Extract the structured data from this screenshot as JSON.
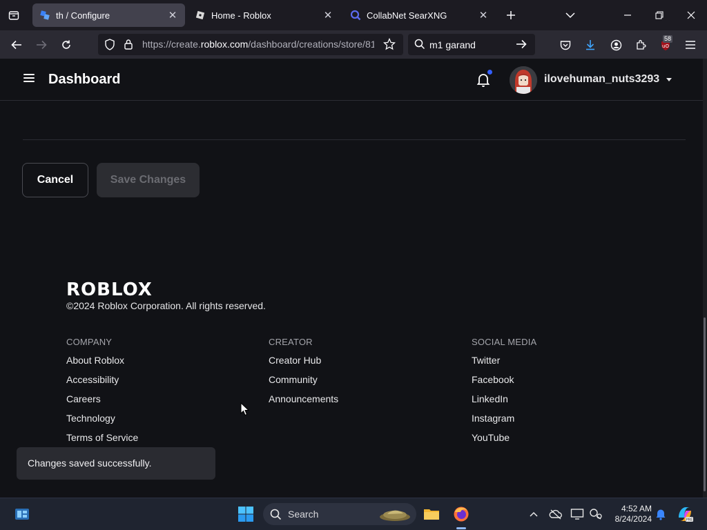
{
  "browser": {
    "tabs": [
      {
        "title": "th / Configure",
        "active": true,
        "icon": "roblox-creator-icon"
      },
      {
        "title": "Home - Roblox",
        "active": false,
        "icon": "roblox-icon"
      },
      {
        "title": "CollabNet SearXNG",
        "active": false,
        "icon": "searxng-icon"
      }
    ],
    "url_prefix": "https://create.",
    "url_domain": "roblox.com",
    "url_rest": "/dashboard/creations/store/81",
    "search_query": "m1 garand",
    "extension_badge": "58"
  },
  "header": {
    "title": "Dashboard",
    "username": "ilovehuman_nuts3293"
  },
  "actions": {
    "cancel_label": "Cancel",
    "save_label": "Save Changes"
  },
  "footer": {
    "logo": "ROBLOX",
    "copyright": "©2024 Roblox Corporation. All rights reserved.",
    "columns": [
      {
        "heading": "COMPANY",
        "links": [
          "About Roblox",
          "Accessibility",
          "Careers",
          "Technology",
          "Terms of Service"
        ]
      },
      {
        "heading": "CREATOR",
        "links": [
          "Creator Hub",
          "Community",
          "Announcements"
        ]
      },
      {
        "heading": "SOCIAL MEDIA",
        "links": [
          "Twitter",
          "Facebook",
          "LinkedIn",
          "Instagram",
          "YouTube"
        ]
      }
    ]
  },
  "toast": {
    "message": "Changes saved successfully."
  },
  "taskbar": {
    "search_label": "Search",
    "time": "4:52 AM",
    "date": "8/24/2024"
  },
  "colors": {
    "page_bg": "#111216",
    "notification_dot": "#335fff",
    "save_disabled_bg": "#2c2d32"
  }
}
